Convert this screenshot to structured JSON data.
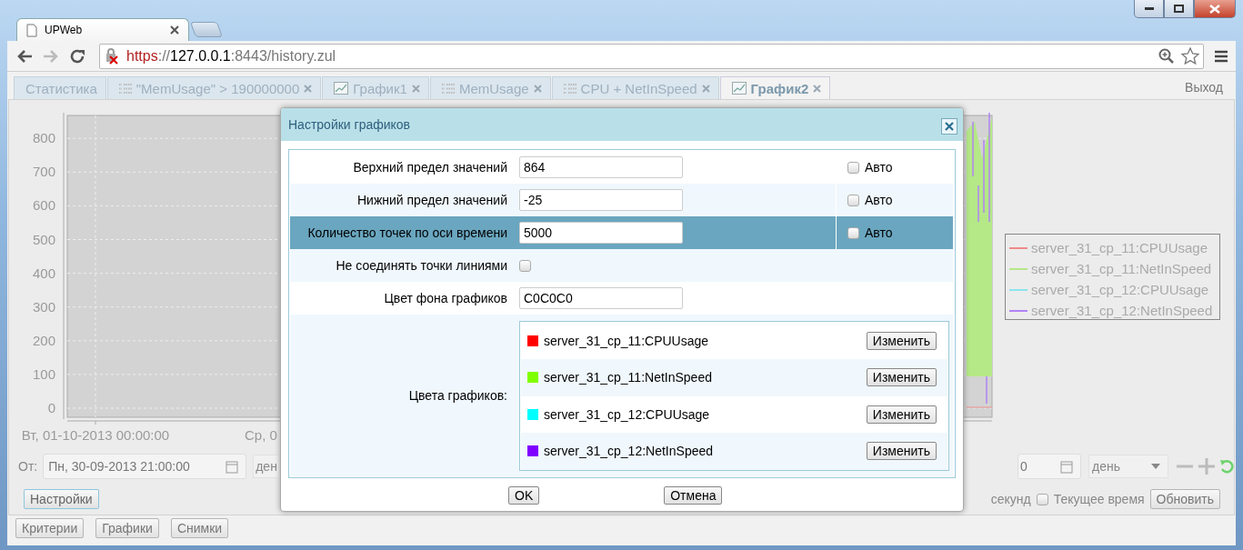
{
  "browser": {
    "tab_title": "UPWeb",
    "url_parts": [
      {
        "text": "https",
        "kind": "insecure"
      },
      {
        "text": "://",
        "kind": "dim"
      },
      {
        "text": "127.0.0.1",
        "kind": "host"
      },
      {
        "text": ":8443/history.zul",
        "kind": "dim"
      }
    ]
  },
  "app_tabs": [
    {
      "label": "Статистика",
      "kind": "plain",
      "selected": false
    },
    {
      "label": "\"MemUsage\" > 190000000",
      "kind": "table",
      "selected": false
    },
    {
      "label": "График1",
      "kind": "chart",
      "selected": false
    },
    {
      "label": "MemUsage",
      "kind": "table",
      "selected": false
    },
    {
      "label": "CPU + NetInSpeed",
      "kind": "table",
      "selected": false
    },
    {
      "label": "График2",
      "kind": "chart",
      "selected": true
    }
  ],
  "logout": "Выход",
  "chart": {
    "y_ticks": [
      "800",
      "700",
      "600",
      "500",
      "400",
      "300",
      "200",
      "100",
      "0"
    ],
    "x_labels": [
      "Вт, 01-10-2013 00:00:00",
      "Ср, 0"
    ],
    "legend": [
      {
        "name": "server_31_cp_11:CPUUsage",
        "color": "#f08a8a"
      },
      {
        "name": "server_31_cp_11:NetInSpeed",
        "color": "#b5e887"
      },
      {
        "name": "server_31_cp_12:CPUUsage",
        "color": "#8be6ec"
      },
      {
        "name": "server_31_cp_12:NetInSpeed",
        "color": "#b184f5"
      }
    ]
  },
  "controls": {
    "from_label": "От:",
    "from_value": "Пн, 30-09-2013 21:00:00",
    "from_unit": "ден",
    "to_value": "0",
    "to_unit": "день",
    "settings_button": "Настройки",
    "seconds_label": "секунд",
    "current_time": {
      "label": "Текущее время",
      "checked": false
    },
    "refresh_button": "Обновить"
  },
  "footer_buttons": [
    "Критерии",
    "Графики",
    "Снимки"
  ],
  "dialog": {
    "title": "Настройки графиков",
    "rows": [
      {
        "kind": "field",
        "label": "Верхний предел значений",
        "value": "864",
        "auto": {
          "label": "Авто",
          "checked": false
        },
        "selected": false
      },
      {
        "kind": "field",
        "label": "Нижний предел значений",
        "value": "-25",
        "auto": {
          "label": "Авто",
          "checked": false
        },
        "selected": false
      },
      {
        "kind": "field",
        "label": "Количество точек по оси времени",
        "value": "5000",
        "auto": {
          "label": "Авто",
          "checked": false
        },
        "selected": true
      },
      {
        "kind": "checkbox",
        "label": "Не соединять точки линиями",
        "checked": false,
        "selected": false
      },
      {
        "kind": "field",
        "label": "Цвет фона графиков",
        "value": "C0C0C0",
        "selected": false
      },
      {
        "kind": "colors",
        "label": "Цвета графиков:",
        "selected": false,
        "series": [
          {
            "name": "server_31_cp_11:CPUUsage",
            "color": "#ff0000",
            "button": "Изменить"
          },
          {
            "name": "server_31_cp_11:NetInSpeed",
            "color": "#80ff00",
            "button": "Изменить"
          },
          {
            "name": "server_31_cp_12:CPUUsage",
            "color": "#00ffff",
            "button": "Изменить"
          },
          {
            "name": "server_31_cp_12:NetInSpeed",
            "color": "#8000ff",
            "button": "Изменить"
          }
        ]
      }
    ],
    "ok_button": "OK",
    "cancel_button": "Отмена"
  }
}
